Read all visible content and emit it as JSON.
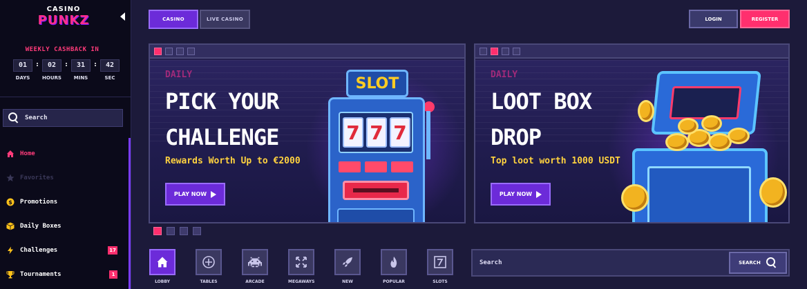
{
  "brand": {
    "line1": "CASINO",
    "line2": "PUNKZ"
  },
  "cashback": {
    "title": "WEEKLY CASHBACK IN",
    "units": [
      {
        "value": "01",
        "label": "DAYS"
      },
      {
        "value": "02",
        "label": "HOURS"
      },
      {
        "value": "31",
        "label": "MINS"
      },
      {
        "value": "42",
        "label": "SEC"
      }
    ]
  },
  "sidebar": {
    "search_label": "Search",
    "items": [
      {
        "label": "Home",
        "icon": "house-icon",
        "state": "active"
      },
      {
        "label": "Favorites",
        "icon": "star-icon",
        "state": "disabled"
      },
      {
        "label": "Promotions",
        "icon": "dollar-coin-icon",
        "state": "normal"
      },
      {
        "label": "Daily Boxes",
        "icon": "box-icon",
        "state": "normal"
      },
      {
        "label": "Challenges",
        "icon": "lightning-icon",
        "state": "normal",
        "badge": "17"
      },
      {
        "label": "Tournaments",
        "icon": "trophy-icon",
        "state": "normal",
        "badge": "1"
      }
    ]
  },
  "tabs": {
    "casino": "CASINO",
    "live_casino": "LIVE CASINO",
    "active": "casino"
  },
  "auth": {
    "login": "LOGIN",
    "register": "REGISTER"
  },
  "banners": [
    {
      "kicker": "DAILY",
      "title_line1": "PICK YOUR",
      "title_line2": "CHALLENGE",
      "subtitle": "Rewards Worth Up to €2000",
      "cta": "PLAY NOW",
      "slot_sign": "SLOT",
      "reels": [
        "7",
        "7",
        "7"
      ]
    },
    {
      "kicker": "DAILY",
      "title_line1": "LOOT BOX",
      "title_line2": "DROP",
      "subtitle": "Top loot worth 1000 USDT",
      "cta": "PLAY NOW"
    }
  ],
  "carousel": {
    "count": 4,
    "active_index": 0
  },
  "categories": [
    {
      "label": "LOBBY",
      "icon": "house-icon",
      "glyph": "⌂"
    },
    {
      "label": "TABLES",
      "icon": "chip-icon",
      "glyph": "⊕"
    },
    {
      "label": "ARCADE",
      "icon": "space-invader-icon",
      "glyph": "👾"
    },
    {
      "label": "MEGAWAYS",
      "icon": "expand-arrows-icon",
      "glyph": "⤧"
    },
    {
      "label": "NEW",
      "icon": "rocket-icon",
      "glyph": "🚀"
    },
    {
      "label": "POPULAR",
      "icon": "flame-icon",
      "glyph": "🔥"
    },
    {
      "label": "SLOTS",
      "icon": "slot-seven-icon",
      "glyph": "7"
    }
  ],
  "main_search": {
    "placeholder": "Search",
    "button": "SEARCH"
  },
  "colors": {
    "accent_purple": "#6c2bd9",
    "accent_pink": "#ff2f6e",
    "gold": "#ffd23f",
    "bg": "#1c1a3a"
  }
}
